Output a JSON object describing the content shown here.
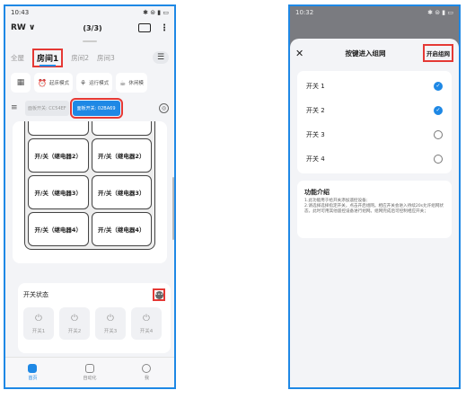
{
  "left": {
    "status_bar": {
      "time": "10:43",
      "icons": "✱ ⊜ ▮ ▭"
    },
    "app_bar": {
      "title": "RW ∨",
      "count": "(3/3)",
      "more": "⋮"
    },
    "tabs": [
      {
        "label": "全屋",
        "active": false
      },
      {
        "label": "房间1",
        "active": true
      },
      {
        "label": "房间2",
        "active": false
      },
      {
        "label": "房间3",
        "active": false
      }
    ],
    "tabs_menu": "☰",
    "scenes": [
      {
        "icon": "⏰",
        "label": "起床模式"
      },
      {
        "icon": "⚘",
        "label": "运行模式"
      },
      {
        "icon": "☕",
        "label": "休闲模"
      }
    ],
    "panels": {
      "off": "面板开关: CC54EF",
      "on": "面板开关: 02BA69"
    },
    "relays": [
      "开/关（继电器2）",
      "开/关（继电器2）",
      "开/关（继电器3）",
      "开/关（继电器3）",
      "开/关（继电器4）",
      "开/关（继电器4）"
    ],
    "switch_status": {
      "title": "开关状态",
      "items": [
        "开关1",
        "开关2",
        "开关3",
        "开关4"
      ]
    },
    "bottom_nav": [
      {
        "label": "首页",
        "active": true
      },
      {
        "label": "自动化",
        "active": false
      },
      {
        "label": "我",
        "active": false
      }
    ]
  },
  "right": {
    "status_bar": {
      "time": "10:32",
      "icons": "✱ ⊜ ▮ ▭"
    },
    "sheet": {
      "close": "✕",
      "title": "按键进入组网",
      "action": "开启组网"
    },
    "switches": [
      {
        "label": "开关 1",
        "checked": true
      },
      {
        "label": "开关 2",
        "checked": true
      },
      {
        "label": "开关 3",
        "checked": false
      },
      {
        "label": "开关 4",
        "checked": false
      }
    ],
    "intro": {
      "title": "功能介绍",
      "text": "1.此功能用于给开关添加遥控设备;\n2.请选择选择指定开关，点击开启组网。相应开关会进入待续20s允许组网状态，此时可用其他遥控设备进行组网。组网完成后可控制相应开关；"
    }
  }
}
